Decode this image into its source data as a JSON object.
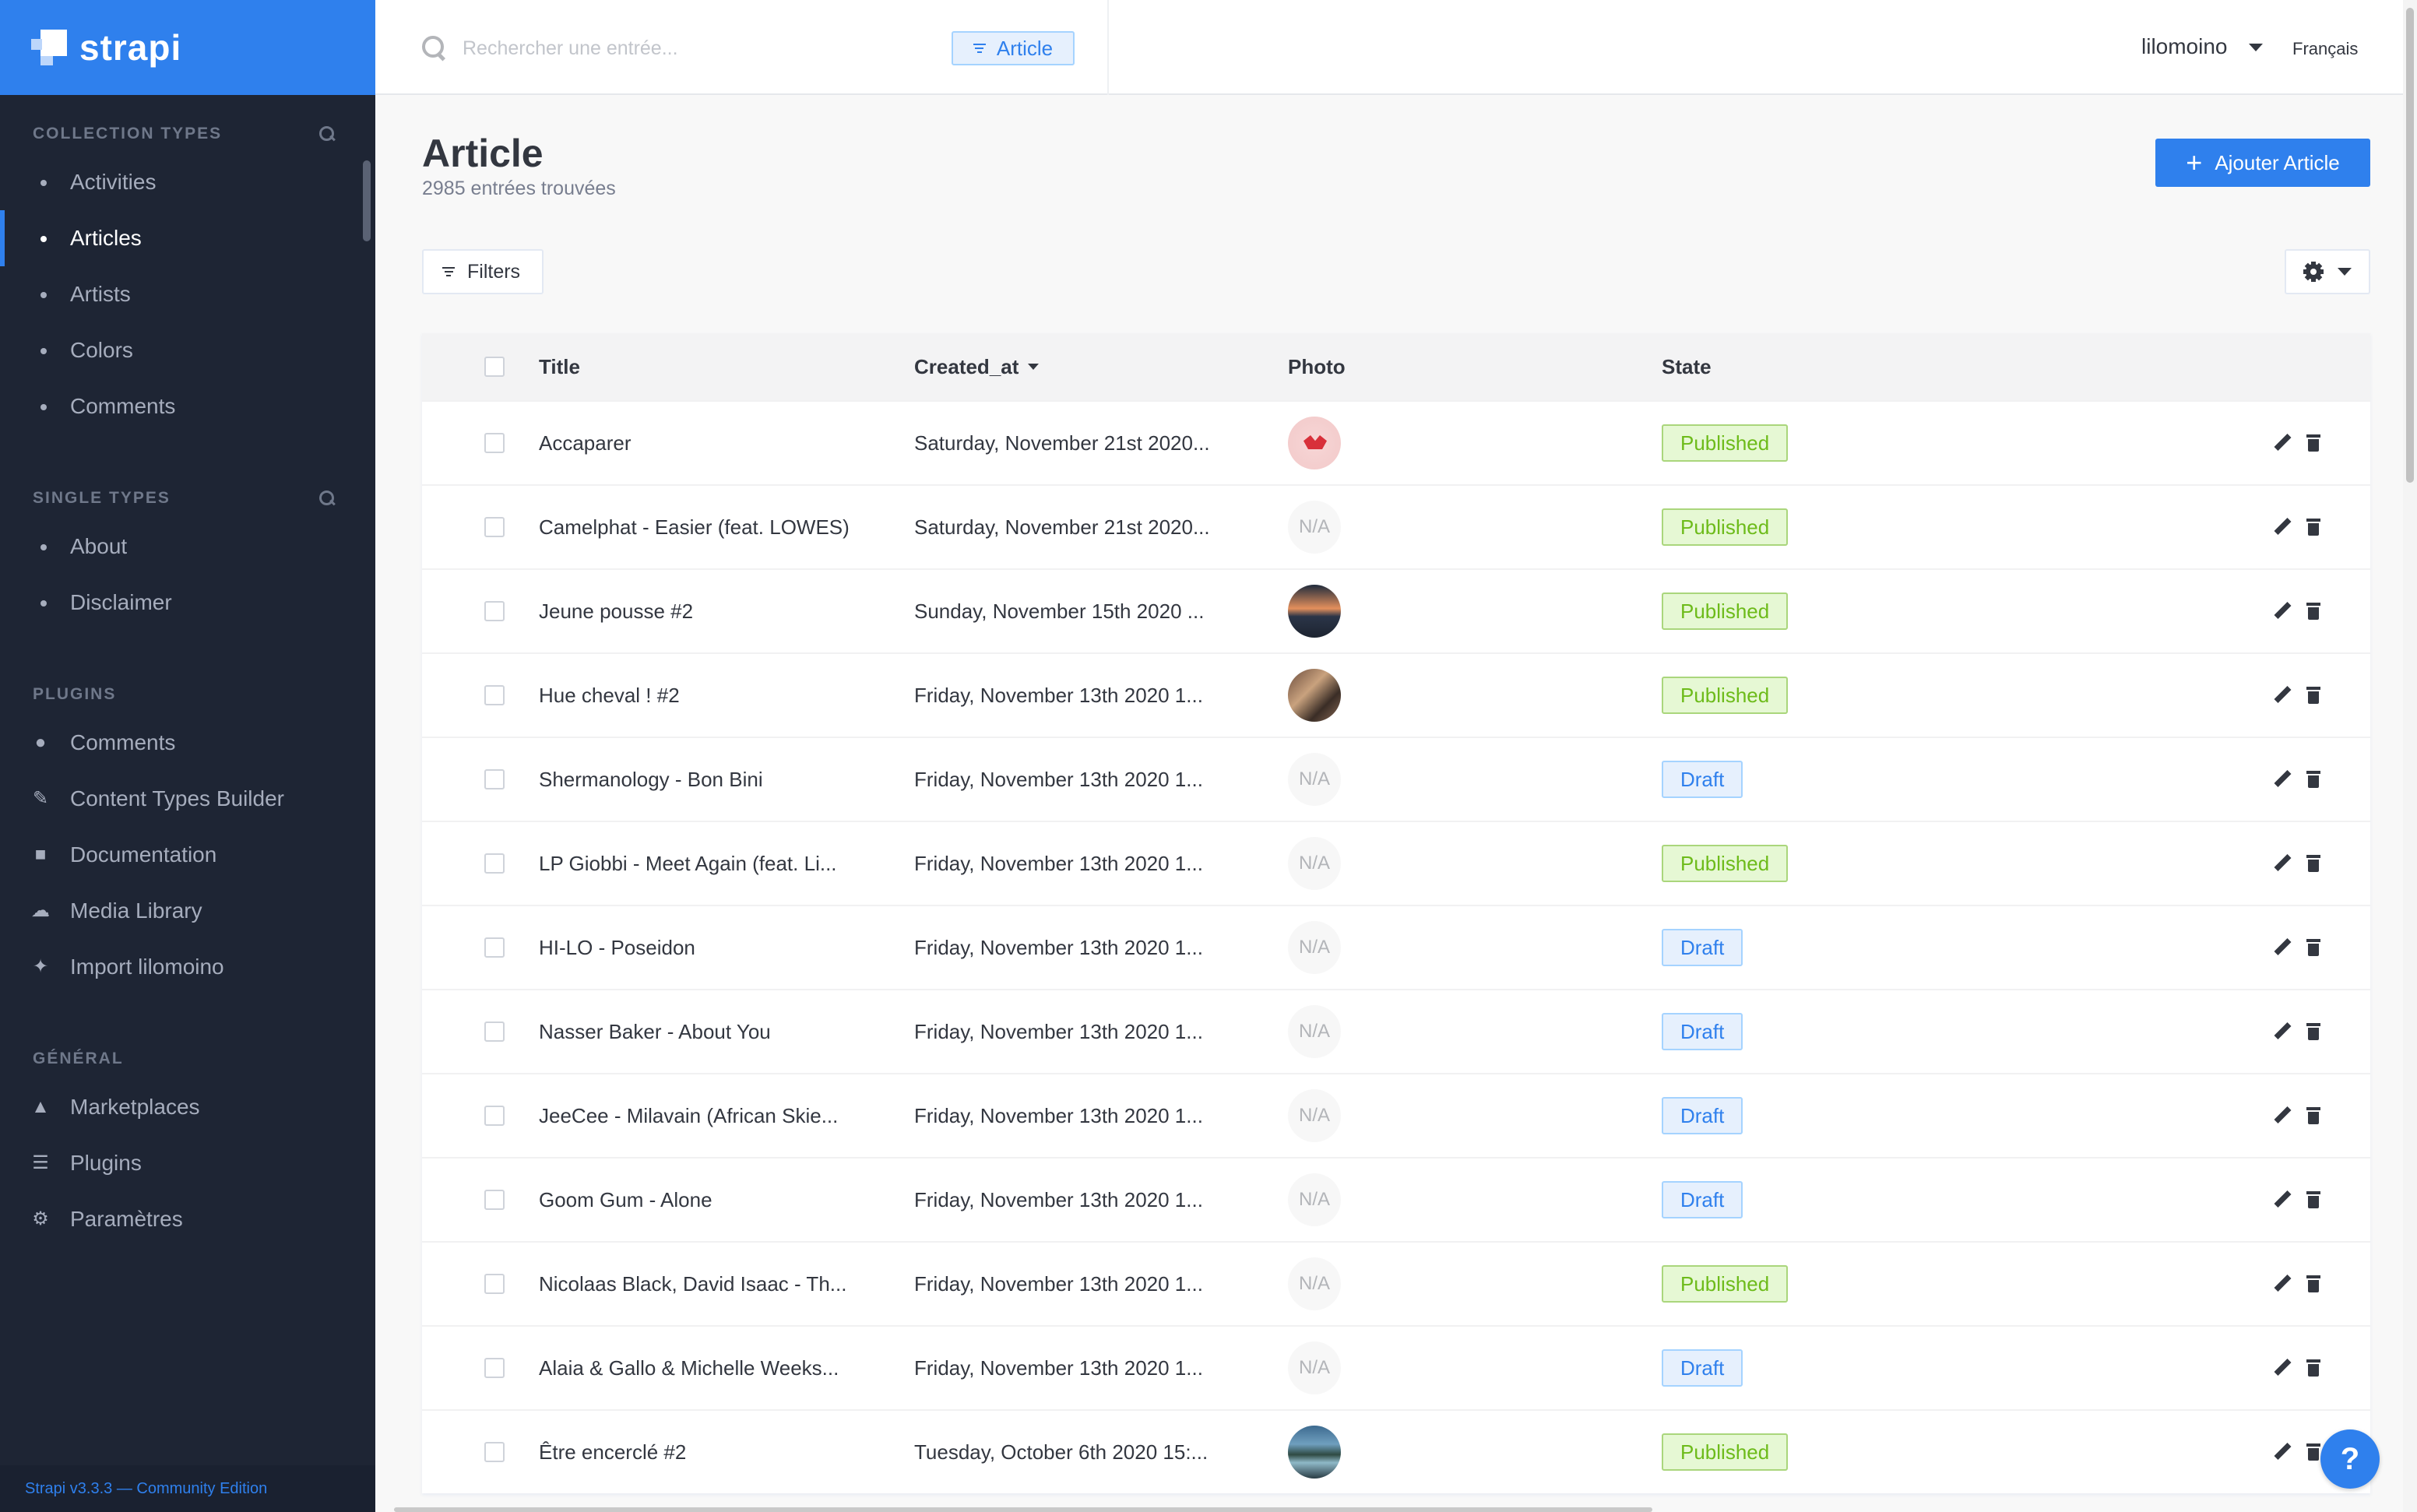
{
  "brand": {
    "name": "strapi"
  },
  "sidebar": {
    "collection_types": {
      "heading": "COLLECTION TYPES",
      "items": [
        {
          "label": "Activities",
          "active": false
        },
        {
          "label": "Articles",
          "active": true
        },
        {
          "label": "Artists",
          "active": false
        },
        {
          "label": "Colors",
          "active": false
        },
        {
          "label": "Comments",
          "active": false
        }
      ]
    },
    "single_types": {
      "heading": "SINGLE TYPES",
      "items": [
        {
          "label": "About"
        },
        {
          "label": "Disclaimer"
        }
      ]
    },
    "plugins": {
      "heading": "PLUGINS",
      "items": [
        {
          "label": "Comments",
          "icon": "comments-icon"
        },
        {
          "label": "Content Types Builder",
          "icon": "paintbrush-icon"
        },
        {
          "label": "Documentation",
          "icon": "book-icon"
        },
        {
          "label": "Media Library",
          "icon": "cloud-upload-icon"
        },
        {
          "label": "Import lilomoino",
          "icon": "plug-icon"
        }
      ]
    },
    "general": {
      "heading": "GÉNÉRAL",
      "items": [
        {
          "label": "Marketplaces",
          "icon": "basket-icon"
        },
        {
          "label": "Plugins",
          "icon": "list-icon"
        },
        {
          "label": "Paramètres",
          "icon": "gear-icon"
        }
      ]
    },
    "footer": "Strapi v3.3.3 — Community Edition"
  },
  "topbar": {
    "search_placeholder": "Rechercher une entrée...",
    "search_tag": "Article",
    "user": "lilomoino",
    "language": "Français"
  },
  "page": {
    "title": "Article",
    "subtitle": "2985 entrées trouvées",
    "add_button": "Ajouter Article",
    "filters_button": "Filters"
  },
  "table": {
    "columns": [
      "Title",
      "Created_at",
      "Photo",
      "State"
    ],
    "sort_column": "Created_at",
    "rows": [
      {
        "title": "Accaparer",
        "created": "Saturday, November 21st 2020...",
        "photo": "flower",
        "state": "Published"
      },
      {
        "title": "Camelphat - Easier (feat. LOWES)",
        "created": "Saturday, November 21st 2020...",
        "photo": "N/A",
        "state": "Published"
      },
      {
        "title": "Jeune pousse #2",
        "created": "Sunday, November 15th 2020 ...",
        "photo": "sunset",
        "state": "Published"
      },
      {
        "title": "Hue cheval ! #2",
        "created": "Friday, November 13th 2020 1...",
        "photo": "food",
        "state": "Published"
      },
      {
        "title": "Shermanology - Bon Bini",
        "created": "Friday, November 13th 2020 1...",
        "photo": "N/A",
        "state": "Draft"
      },
      {
        "title": "LP Giobbi - Meet Again (feat. Li...",
        "created": "Friday, November 13th 2020 1...",
        "photo": "N/A",
        "state": "Published"
      },
      {
        "title": "HI-LO - Poseidon",
        "created": "Friday, November 13th 2020 1...",
        "photo": "N/A",
        "state": "Draft"
      },
      {
        "title": "Nasser Baker - About You",
        "created": "Friday, November 13th 2020 1...",
        "photo": "N/A",
        "state": "Draft"
      },
      {
        "title": "JeeCee - Milavain (African Skie...",
        "created": "Friday, November 13th 2020 1...",
        "photo": "N/A",
        "state": "Draft"
      },
      {
        "title": "Goom Gum - Alone",
        "created": "Friday, November 13th 2020 1...",
        "photo": "N/A",
        "state": "Draft"
      },
      {
        "title": "Nicolaas Black, David Isaac - Th...",
        "created": "Friday, November 13th 2020 1...",
        "photo": "N/A",
        "state": "Published"
      },
      {
        "title": "Alaia & Gallo & Michelle Weeks...",
        "created": "Friday, November 13th 2020 1...",
        "photo": "N/A",
        "state": "Draft"
      },
      {
        "title": "Être encerclé #2",
        "created": "Tuesday, October 6th 2020 15:...",
        "photo": "lake",
        "state": "Published"
      }
    ]
  },
  "help": "?",
  "colors": {
    "accent": "#2f80ed",
    "sidebar": "#1e2534",
    "published_text": "#6dbb1a",
    "draft_text": "#2f80ed"
  }
}
